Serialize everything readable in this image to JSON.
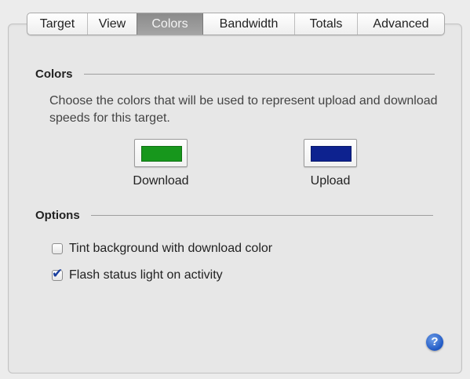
{
  "tabs": [
    {
      "label": "Target",
      "active": false
    },
    {
      "label": "View",
      "active": false
    },
    {
      "label": "Colors",
      "active": true
    },
    {
      "label": "Bandwidth",
      "active": false
    },
    {
      "label": "Totals",
      "active": false
    },
    {
      "label": "Advanced",
      "active": false
    }
  ],
  "colors_section": {
    "title": "Colors",
    "description": "Choose the colors that will be used to represent upload and download speeds for this target.",
    "download": {
      "label": "Download",
      "color": "#17971c"
    },
    "upload": {
      "label": "Upload",
      "color": "#0d228f"
    }
  },
  "options_section": {
    "title": "Options",
    "tint_background": {
      "label": "Tint background with download color",
      "checked": false
    },
    "flash_status": {
      "label": "Flash status light on activity",
      "checked": true
    }
  },
  "help": {
    "icon": "help-icon",
    "symbol": "?",
    "color": "#1f58c4"
  },
  "checkmark": "✔"
}
